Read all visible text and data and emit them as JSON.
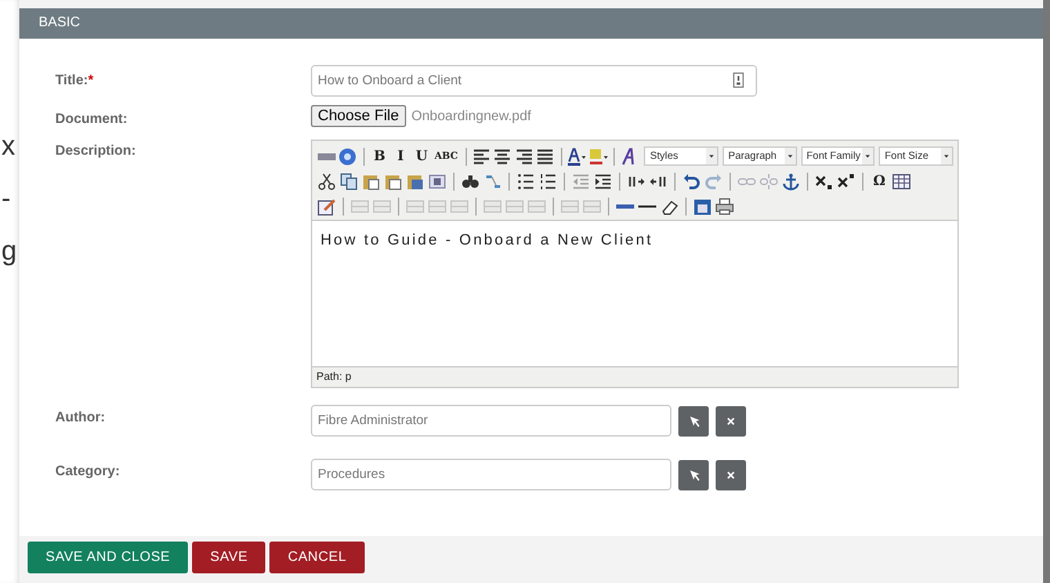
{
  "background_text": [
    "x",
    "-",
    "g"
  ],
  "section": {
    "title": "BASIC"
  },
  "fields": [
    {
      "kind": "text",
      "label": "Title:",
      "required_mark": "*",
      "value": "How to Onboard a Client"
    },
    {
      "kind": "file",
      "label": "Document:",
      "button": "Choose File",
      "file_name": "Onboardingnew.pdf"
    },
    {
      "kind": "editor",
      "label": "Description:",
      "content": "How to Guide - Onboard a New Client",
      "status": "Path: p",
      "toolbar": [
        [
          {
            "kind": "icon",
            "disabled": false
          },
          {
            "kind": "icon",
            "disabled": false
          },
          {
            "kind": "sep"
          },
          {
            "kind": "glyph",
            "text": "B"
          },
          {
            "kind": "glyph",
            "text": "I"
          },
          {
            "kind": "glyph",
            "text": "U"
          },
          {
            "kind": "glyph",
            "text": "ABC"
          },
          {
            "kind": "sep"
          },
          {
            "kind": "icon",
            "disabled": false
          },
          {
            "kind": "icon",
            "disabled": false
          },
          {
            "kind": "icon",
            "disabled": false
          },
          {
            "kind": "icon",
            "disabled": false
          },
          {
            "kind": "sep"
          },
          {
            "kind": "icon",
            "disabled": false
          },
          {
            "kind": "icon",
            "disabled": false
          },
          {
            "kind": "sep"
          },
          {
            "kind": "icon",
            "disabled": false
          },
          {
            "kind": "select",
            "text": "Styles"
          },
          {
            "kind": "select",
            "text": "Paragraph"
          },
          {
            "kind": "select",
            "text": "Font Family"
          },
          {
            "kind": "select",
            "text": "Font Size"
          }
        ],
        [
          {
            "kind": "icon",
            "disabled": false
          },
          {
            "kind": "icon",
            "disabled": false
          },
          {
            "kind": "icon",
            "disabled": false
          },
          {
            "kind": "icon",
            "disabled": false
          },
          {
            "kind": "icon",
            "disabled": false
          },
          {
            "kind": "icon",
            "disabled": false
          },
          {
            "kind": "sep"
          },
          {
            "kind": "icon",
            "disabled": false
          },
          {
            "kind": "icon",
            "disabled": false
          },
          {
            "kind": "sep"
          },
          {
            "kind": "icon",
            "disabled": false
          },
          {
            "kind": "icon",
            "disabled": false
          },
          {
            "kind": "sep"
          },
          {
            "kind": "icon",
            "disabled": true
          },
          {
            "kind": "icon",
            "disabled": false
          },
          {
            "kind": "sep"
          },
          {
            "kind": "icon",
            "disabled": false
          },
          {
            "kind": "icon",
            "disabled": false
          },
          {
            "kind": "sep"
          },
          {
            "kind": "icon",
            "disabled": false
          },
          {
            "kind": "icon",
            "disabled": true
          },
          {
            "kind": "sep"
          },
          {
            "kind": "icon",
            "disabled": true
          },
          {
            "kind": "icon",
            "disabled": true
          },
          {
            "kind": "icon",
            "disabled": false
          },
          {
            "kind": "sep"
          },
          {
            "kind": "icon",
            "disabled": false
          },
          {
            "kind": "icon",
            "disabled": false
          },
          {
            "kind": "sep"
          },
          {
            "kind": "glyph",
            "text": "Ω"
          },
          {
            "kind": "icon",
            "disabled": false
          }
        ],
        [
          {
            "kind": "icon",
            "disabled": false
          },
          {
            "kind": "sep"
          },
          {
            "kind": "icon",
            "disabled": true
          },
          {
            "kind": "icon",
            "disabled": true
          },
          {
            "kind": "sep"
          },
          {
            "kind": "icon",
            "disabled": true
          },
          {
            "kind": "icon",
            "disabled": true
          },
          {
            "kind": "icon",
            "disabled": true
          },
          {
            "kind": "sep"
          },
          {
            "kind": "icon",
            "disabled": true
          },
          {
            "kind": "icon",
            "disabled": true
          },
          {
            "kind": "icon",
            "disabled": true
          },
          {
            "kind": "sep"
          },
          {
            "kind": "icon",
            "disabled": true
          },
          {
            "kind": "icon",
            "disabled": true
          },
          {
            "kind": "sep"
          },
          {
            "kind": "icon",
            "disabled": false
          },
          {
            "kind": "icon",
            "disabled": false
          },
          {
            "kind": "icon",
            "disabled": false
          },
          {
            "kind": "sep"
          },
          {
            "kind": "icon",
            "disabled": false
          },
          {
            "kind": "icon",
            "disabled": false
          }
        ]
      ]
    },
    {
      "kind": "relate",
      "label": "Author:",
      "value": "Fibre Administrator"
    },
    {
      "kind": "relate",
      "label": "Category:",
      "value": "Procedures"
    }
  ],
  "buttons": [
    {
      "label": "SAVE AND CLOSE",
      "kind": "primary"
    },
    {
      "label": "SAVE",
      "kind": "danger"
    },
    {
      "label": "CANCEL",
      "kind": "danger"
    }
  ]
}
